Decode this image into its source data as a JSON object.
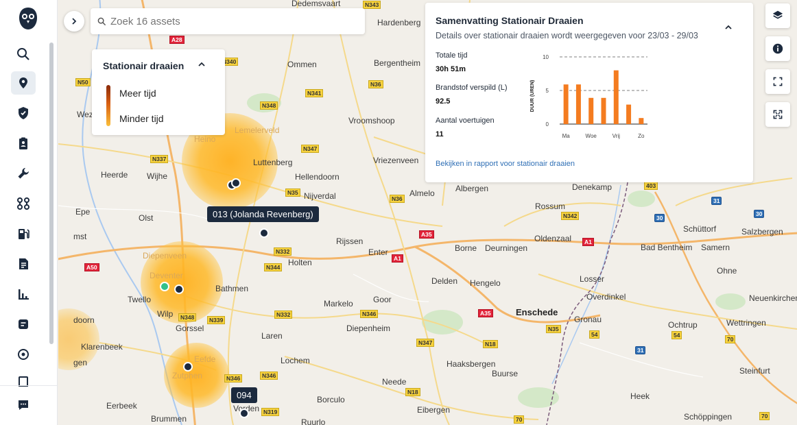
{
  "search": {
    "placeholder": "Zoek 16 assets"
  },
  "legend": {
    "title": "Stationair draaien",
    "more_label": "Meer tijd",
    "less_label": "Minder tijd"
  },
  "summary": {
    "title": "Samenvatting Stationair Draaien",
    "subtitle": "Details over stationair draaien wordt weergegeven voor 23/03 - 29/03",
    "stats": [
      {
        "label": "Totale tijd",
        "value": "30h 51m"
      },
      {
        "label": "Brandstof verspild (L)",
        "value": "92.5"
      },
      {
        "label": "Aantal voertuigen",
        "value": "11"
      }
    ],
    "link": "Bekijken in rapport voor stationair draaien"
  },
  "chart_data": {
    "type": "bar",
    "categories": [
      "Ma",
      "",
      "Woe",
      "",
      "Vrij",
      "",
      "Zo"
    ],
    "tick_labels": [
      "Ma",
      "Woe",
      "Vrij",
      "Zo"
    ],
    "values": [
      5.9,
      5.9,
      3.9,
      3.9,
      8.0,
      2.9,
      0.9
    ],
    "ylabel": "DUUR (UREN)",
    "ylim": [
      0,
      10
    ],
    "yticks": [
      "0",
      "5",
      "10"
    ],
    "color": "#f47c20",
    "grid": "dashed"
  },
  "vehicles": [
    {
      "label": "013 (Jolanda Revenberg)"
    },
    {
      "label": "094"
    }
  ],
  "map_labels": {
    "places": [
      "Dedemsvaart",
      "Hardenberg",
      "Ommen",
      "Bergentheim",
      "Lemelerveld",
      "Vroomshoop",
      "Heino",
      "Luttenberg",
      "Vriezenveen",
      "Heerde",
      "Wijhe",
      "Hellendoorn",
      "Nijverdal",
      "Almelo",
      "Albergen",
      "Denekamp",
      "Rossum",
      "Epe",
      "Olst",
      "Diepenveen",
      "Rijssen",
      "Enter",
      "Borne",
      "Deurningen",
      "Oldenzaal",
      "Holten",
      "Deventer",
      "Bathmen",
      "Twello",
      "Markelo",
      "Goor",
      "Delden",
      "Hengelo",
      "Losser",
      "Overdinkel",
      "Enschede",
      "Gronau",
      "Wilp",
      "Gorssel",
      "Laren",
      "Diepenheim",
      "Klarenbeek",
      "Lochem",
      "Haaksbergen",
      "Buurse",
      "Eefde",
      "Zutphen",
      "Neede",
      "Eerbeek",
      "Borculo",
      "Vorden",
      "Eibergen",
      "Brummen",
      "Ruurlo",
      "Heek",
      "Schöppingen",
      "Schüttorf",
      "Salzbergen",
      "Bad Bentheim",
      "Samern",
      "Ohne",
      "Neuenkirchen",
      "Ochtrup",
      "Wettringen",
      "Steinfurt",
      "Wez",
      "mst",
      "doorn",
      "gen"
    ],
    "roads": [
      "N343",
      "A28",
      "N340",
      "N341",
      "N348",
      "N36",
      "N347",
      "N337",
      "N35",
      "N36",
      "N342",
      "A35",
      "N332",
      "N344",
      "A1",
      "A50",
      "N348",
      "N339",
      "N332",
      "N346",
      "A35",
      "N35",
      "N347",
      "N18",
      "N346",
      "N346",
      "N18",
      "N319",
      "403",
      "31",
      "30",
      "30",
      "A1",
      "54",
      "54",
      "70",
      "31",
      "70",
      "70",
      "N50"
    ]
  }
}
